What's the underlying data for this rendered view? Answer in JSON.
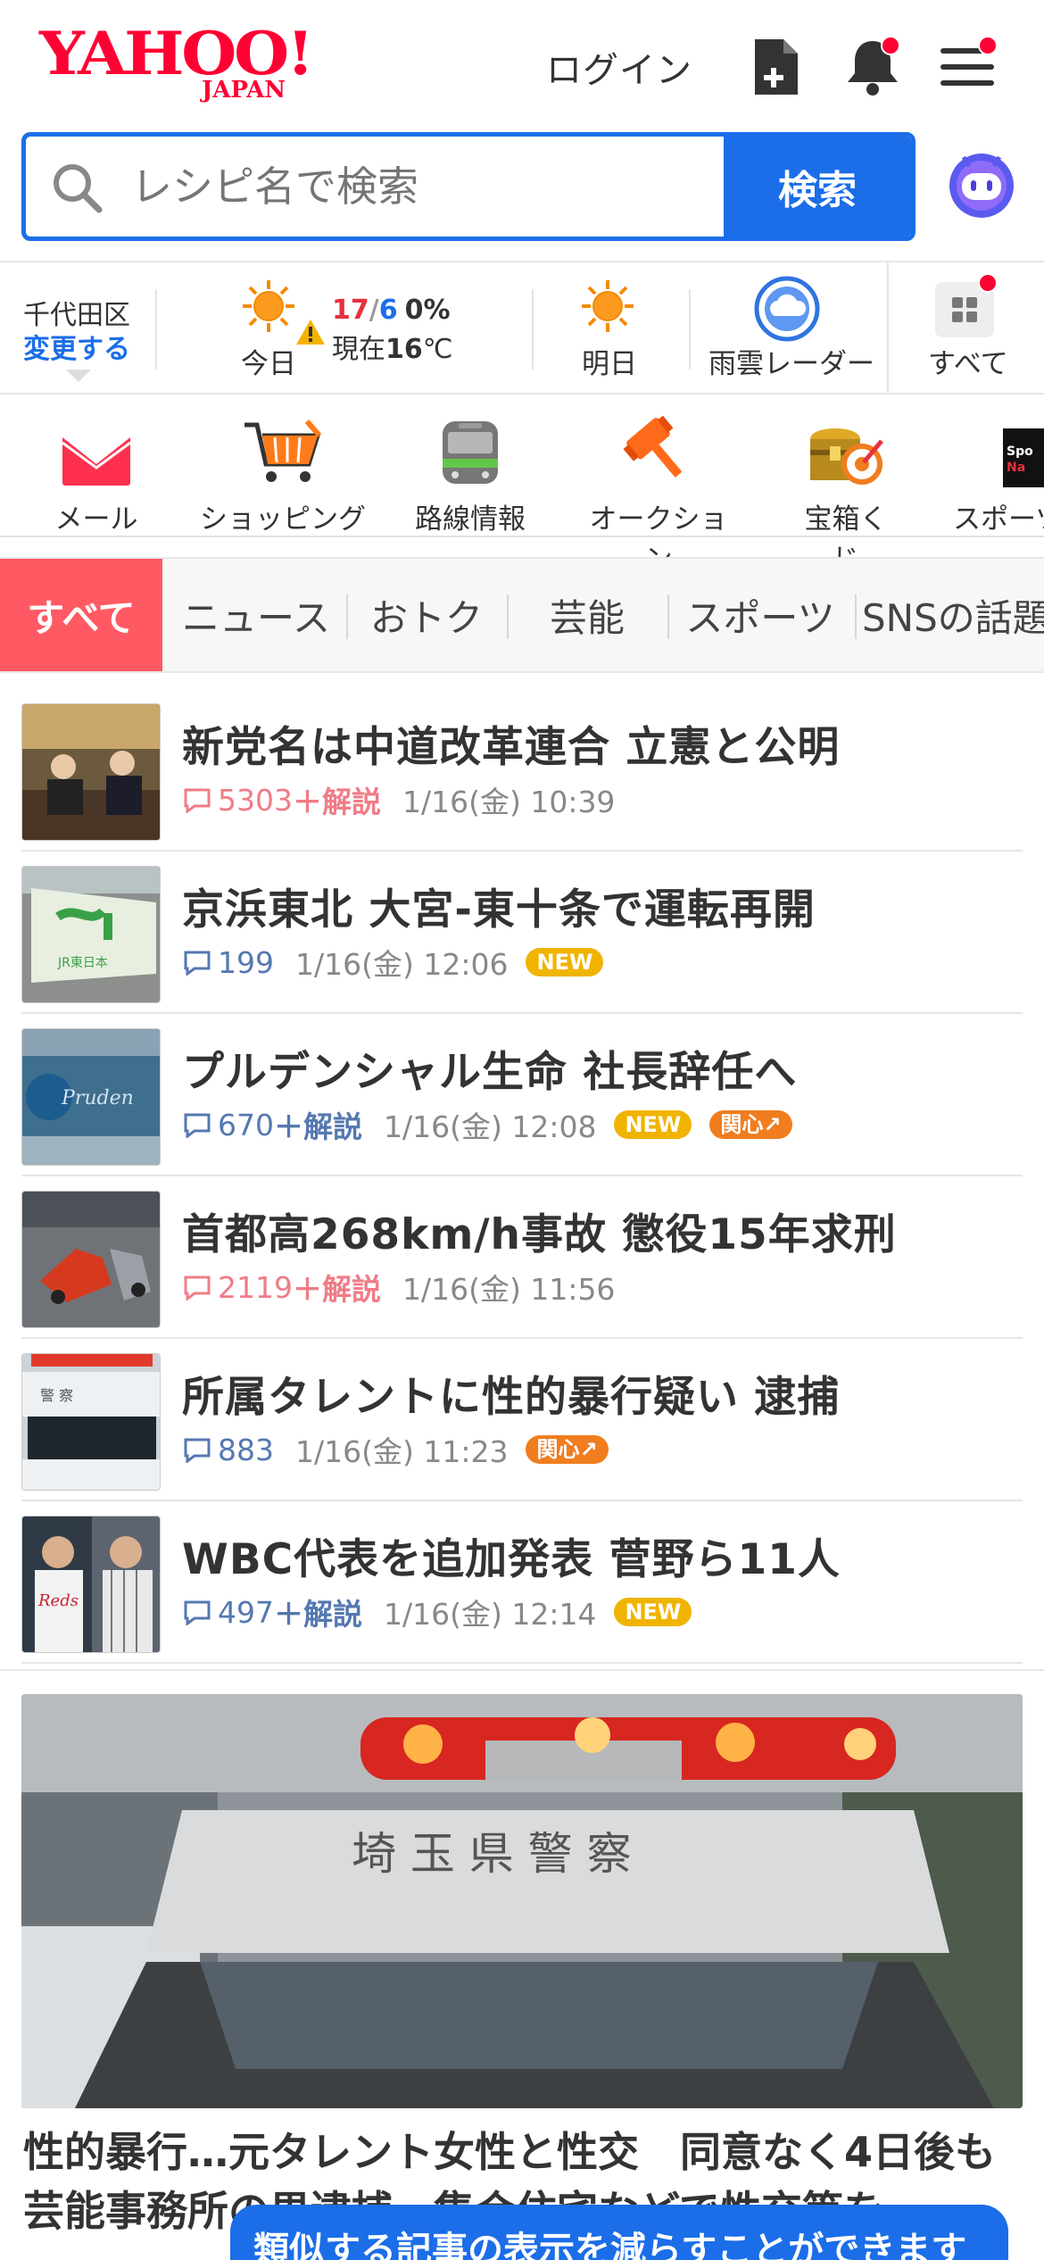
{
  "header": {
    "logo_text": "YAHOO!",
    "logo_sub": "JAPAN",
    "login_label": "ログイン"
  },
  "search": {
    "placeholder": "レシピ名で検索",
    "button_label": "検索"
  },
  "weather": {
    "area": "千代田区",
    "change_label": "変更する",
    "today_label": "今日",
    "high": "17",
    "slash": "/",
    "low": "6",
    "rain": "0%",
    "current_prefix": "現在",
    "current_temp": "16",
    "current_unit": "℃",
    "tomorrow_label": "明日",
    "radar_label": "雨雲レーダー",
    "all_label": "すべて"
  },
  "services": [
    {
      "label": "メール",
      "icon": "mail-icon"
    },
    {
      "label": "ショッピング",
      "icon": "cart-icon"
    },
    {
      "label": "路線情報",
      "icon": "train-icon"
    },
    {
      "label": "オークション",
      "icon": "auction-hammer-icon"
    },
    {
      "label": "宝箱くじ",
      "icon": "treasure-box-icon"
    },
    {
      "label": "スポーツ",
      "icon": "sports-icon"
    }
  ],
  "tabs": [
    "すべて",
    "ニュース",
    "おトク",
    "芸能",
    "スポーツ",
    "SNSの話題"
  ],
  "news": [
    {
      "title": "新党名は中道改革連合 立憲と公明",
      "comments": "5303",
      "kaisetsu": "＋解説",
      "time": "1/16(金) 10:39",
      "badges": []
    },
    {
      "title": "京浜東北 大宮-東十条で運転再開",
      "comments": "199",
      "kaisetsu": "",
      "time": "1/16(金) 12:06",
      "badges": [
        "NEW"
      ]
    },
    {
      "title": "プルデンシャル生命 社長辞任へ",
      "comments": "670",
      "kaisetsu": "＋解説",
      "time": "1/16(金) 12:08",
      "badges": [
        "NEW",
        "関心↗"
      ]
    },
    {
      "title": "首都高268km/h事故 懲役15年求刑",
      "comments": "2119",
      "kaisetsu": "＋解説",
      "time": "1/16(金) 11:56",
      "badges": []
    },
    {
      "title": "所属タレントに性的暴行疑い 逮捕",
      "comments": "883",
      "kaisetsu": "",
      "time": "1/16(金) 11:23",
      "badges": [
        "関心↗"
      ]
    },
    {
      "title": "WBC代表を追加発表 菅野ら11人",
      "comments": "497",
      "kaisetsu": "＋解説",
      "time": "1/16(金) 12:14",
      "badges": [
        "NEW"
      ]
    }
  ],
  "big_article": {
    "car_text": "埼 玉 県 警 察",
    "title": "性的暴行…元タレント女性と性交　同意なく4日後も　芸能事務所の男逮捕　集合住宅などで性交等を"
  },
  "toast": "類似する記事の表示を減らすことができます",
  "colors": {
    "brand_red": "#ff0033",
    "accent_blue": "#1b6ee8",
    "active_tab": "#ff5a64",
    "new_badge": "#f0b400",
    "kanshin_badge": "#f07d1e"
  }
}
